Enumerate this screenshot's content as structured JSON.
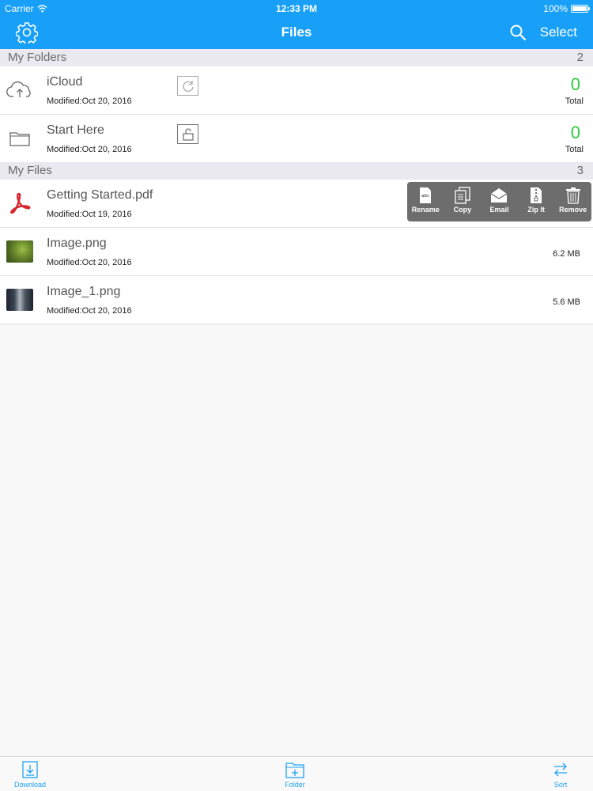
{
  "status_bar": {
    "carrier": "Carrier",
    "time": "12:33 PM",
    "battery": "100%"
  },
  "nav": {
    "title": "Files",
    "select_label": "Select",
    "settings_icon": "gear-icon",
    "search_icon": "search-icon"
  },
  "folders_section": {
    "label": "My Folders",
    "count": "2",
    "items": [
      {
        "name": "iCloud",
        "modified": "Modified:Oct 20, 2016",
        "total": "0",
        "total_label": "Total",
        "icon": "cloud-upload-icon",
        "badge_icon": "refresh-icon"
      },
      {
        "name": "Start Here",
        "modified": "Modified:Oct 20, 2016",
        "total": "0",
        "total_label": "Total",
        "icon": "folder-icon",
        "badge_icon": "unlock-icon"
      }
    ]
  },
  "files_section": {
    "label": "My Files",
    "count": "3",
    "items": [
      {
        "name": "Getting Started.pdf",
        "modified": "Modified:Oct 19, 2016",
        "size": "",
        "icon": "pdf-icon"
      },
      {
        "name": "Image.png",
        "modified": "Modified:Oct 20, 2016",
        "size": "6.2 MB",
        "icon": "image-thumbnail"
      },
      {
        "name": "Image_1.png",
        "modified": "Modified:Oct 20, 2016",
        "size": "5.6 MB",
        "icon": "image-thumbnail"
      }
    ]
  },
  "action_menu": {
    "items": [
      {
        "label": "Rename",
        "icon": "rename-icon"
      },
      {
        "label": "Copy",
        "icon": "copy-icon"
      },
      {
        "label": "Email",
        "icon": "email-icon"
      },
      {
        "label": "Zip It",
        "icon": "zip-icon"
      },
      {
        "label": "Remove",
        "icon": "trash-icon"
      }
    ]
  },
  "tabbar": {
    "download_label": "Download",
    "folder_label": "Folder",
    "sort_label": "Sort"
  },
  "colors": {
    "nav_blue": "#18a0f8",
    "total_green": "#2ccd3b",
    "pdf_red": "#d8262d",
    "menu_gray": "#6d6d6d"
  }
}
